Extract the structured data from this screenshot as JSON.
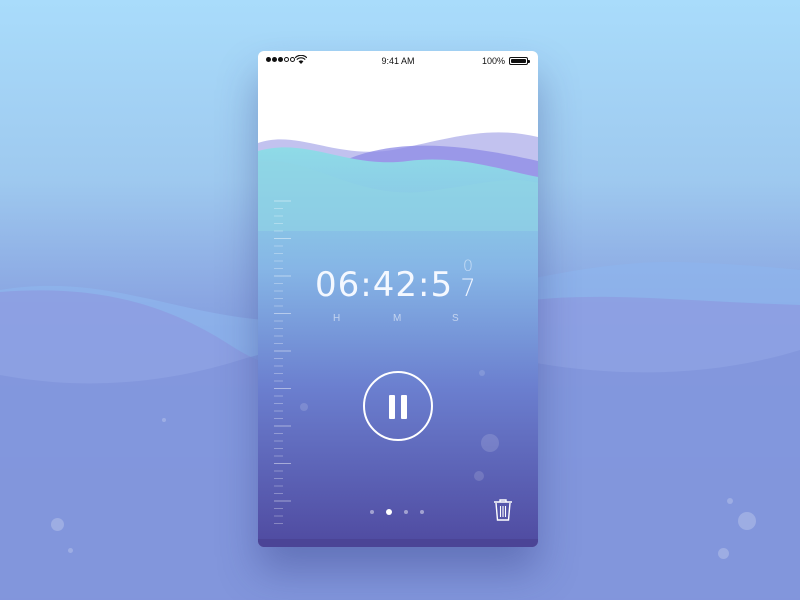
{
  "status_bar": {
    "signal_bars": 5,
    "signal_filled": 3,
    "time": "9:41 AM",
    "battery_text": "100%",
    "battery_level": 1.0
  },
  "timer": {
    "display": "06:42:5",
    "rolling_previous": "0",
    "rolling_current": "7",
    "units": {
      "hours": "H",
      "minutes": "M",
      "seconds": "S"
    }
  },
  "controls": {
    "pause_icon": "pause-icon",
    "trash_icon": "trash-icon"
  },
  "pager": {
    "count": 4,
    "active_index": 1
  },
  "colors": {
    "water_top": "#8fdbe7",
    "water_bottom": "#4f4aa0",
    "background_top": "#a9dcfb",
    "background_bottom": "#5a6ec0"
  }
}
